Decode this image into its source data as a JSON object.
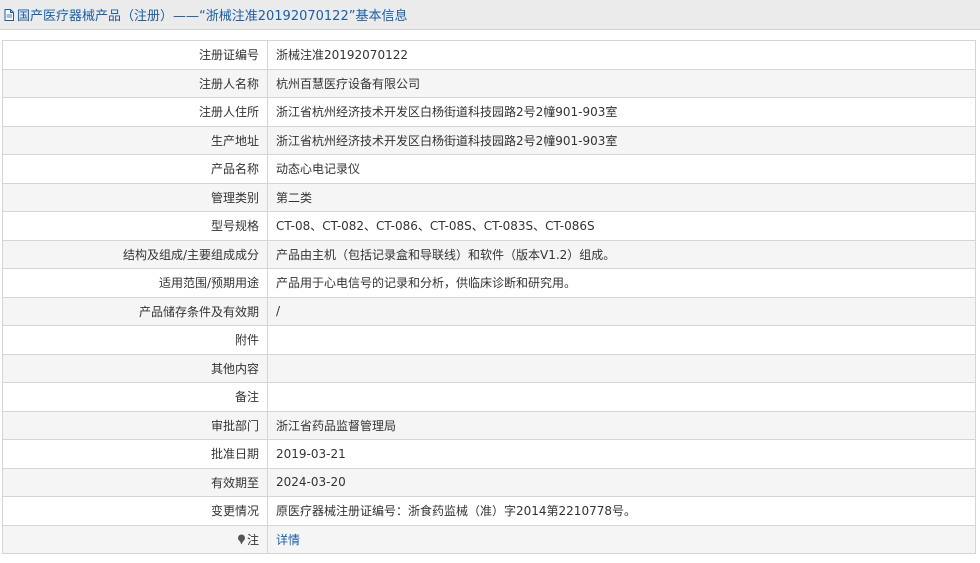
{
  "header": {
    "title": "国产医疗器械产品（注册）——“浙械注准20192070122”基本信息"
  },
  "rows": [
    {
      "label": "注册证编号",
      "value": "浙械注准20192070122"
    },
    {
      "label": "注册人名称",
      "value": "杭州百慧医疗设备有限公司"
    },
    {
      "label": "注册人住所",
      "value": "浙江省杭州经济技术开发区白杨街道科技园路2号2幢901-903室"
    },
    {
      "label": "生产地址",
      "value": "浙江省杭州经济技术开发区白杨街道科技园路2号2幢901-903室"
    },
    {
      "label": "产品名称",
      "value": "动态心电记录仪"
    },
    {
      "label": "管理类别",
      "value": "第二类"
    },
    {
      "label": "型号规格",
      "value": "CT-08、CT-082、CT-086、CT-08S、CT-083S、CT-086S"
    },
    {
      "label": "结构及组成/主要组成成分",
      "value": "产品由主机（包括记录盒和导联线）和软件（版本V1.2）组成。"
    },
    {
      "label": "适用范围/预期用途",
      "value": "产品用于心电信号的记录和分析，供临床诊断和研究用。"
    },
    {
      "label": "产品储存条件及有效期",
      "value": "/"
    },
    {
      "label": "附件",
      "value": ""
    },
    {
      "label": "其他内容",
      "value": ""
    },
    {
      "label": "备注",
      "value": ""
    },
    {
      "label": "审批部门",
      "value": "浙江省药品监督管理局"
    },
    {
      "label": "批准日期",
      "value": "2019-03-21"
    },
    {
      "label": "有效期至",
      "value": "2024-03-20"
    },
    {
      "label": "变更情况",
      "value": "原医疗器械注册证编号：浙食药监械（准）字2014第2210778号。"
    }
  ],
  "note_row": {
    "icon": "pin-icon",
    "label": "注",
    "link_text": "详情"
  }
}
